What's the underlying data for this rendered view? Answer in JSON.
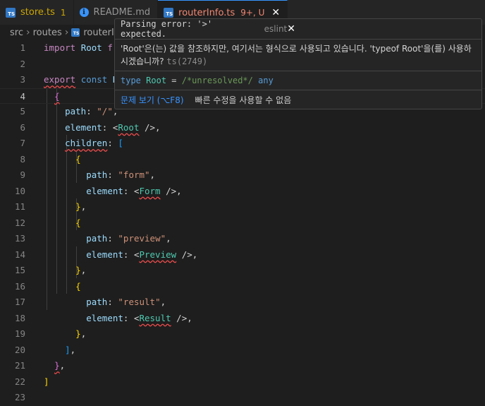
{
  "tabs": [
    {
      "name": "store.ts",
      "badge": "1",
      "icon": "ts-file-icon"
    },
    {
      "name": "README.md",
      "badge": "",
      "icon": "info-icon"
    },
    {
      "name": "routerInfo.ts",
      "badge": "9+, U",
      "icon": "ts-file-icon",
      "close": "✕"
    }
  ],
  "breadcrumb": [
    "src",
    "routes",
    "routerI"
  ],
  "hover": {
    "error1": "Parsing error: '>' expected.",
    "error1_source": "eslint",
    "error2": "'Root'은(는) 값을 참조하지만, 여기서는 형식으로 사용되고 있습니다. 'typeof Root'을(를) 사용하시겠습니까?",
    "error2_code": "ts(2749)",
    "type_kw": "type",
    "type_name": "Root",
    "type_eq": " = ",
    "type_comment": "/*unresolved*/",
    "type_any": " any",
    "action_view": "문제 보기 (⌥F8)",
    "action_fix": "빠른 수정을 사용할 수 없음",
    "close": "✕"
  },
  "code": {
    "l1_import": "import",
    "l1_root": "Root",
    "l1_from": "fr",
    "l3_export": "export",
    "l3_const": "const",
    "l3_r": "R",
    "l5_path": "path",
    "l5_val": "\"/\"",
    "l6_element": "element",
    "l6_tag": "Root",
    "l7_children": "children",
    "l9_path": "path",
    "l9_val": "\"form\"",
    "l10_element": "element",
    "l10_tag": "Form",
    "l13_path": "path",
    "l13_val": "\"preview\"",
    "l14_element": "element",
    "l14_tag": "Preview",
    "l17_path": "path",
    "l17_val": "\"result\"",
    "l18_element": "element",
    "l18_tag": "Result"
  },
  "line_numbers": [
    "1",
    "2",
    "3",
    "4",
    "5",
    "6",
    "7",
    "8",
    "9",
    "10",
    "11",
    "12",
    "13",
    "14",
    "15",
    "16",
    "17",
    "18",
    "19",
    "20",
    "21",
    "22",
    "23"
  ],
  "current_line": "4"
}
